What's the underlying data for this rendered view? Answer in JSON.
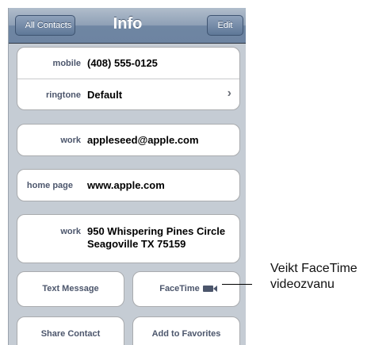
{
  "navbar": {
    "back_label": "All Contacts",
    "title": "Info",
    "edit_label": "Edit"
  },
  "contact": {
    "phone": {
      "label": "mobile",
      "value": "(408) 555-0125"
    },
    "ringtone": {
      "label": "ringtone",
      "value": "Default"
    },
    "email": {
      "label": "work",
      "value": "appleseed@apple.com"
    },
    "homepage": {
      "label": "home page",
      "value": "www.apple.com"
    },
    "address": {
      "label": "work",
      "line1": "950 Whispering Pines Circle",
      "line2": "Seagoville TX 75159"
    }
  },
  "actions": {
    "text_message": "Text Message",
    "facetime": "FaceTime",
    "share_contact": "Share Contact",
    "add_to_favorites": "Add to Favorites"
  },
  "callout": {
    "line1": "Veikt FaceTime",
    "line2": "videozvanu"
  },
  "icons": {
    "facetime": "video-camera-icon",
    "ringtone_disclosure": "chevron-right-icon"
  },
  "colors": {
    "navbar": "#6d84a1",
    "background": "#c5ccd4",
    "label": "#4c566c"
  }
}
